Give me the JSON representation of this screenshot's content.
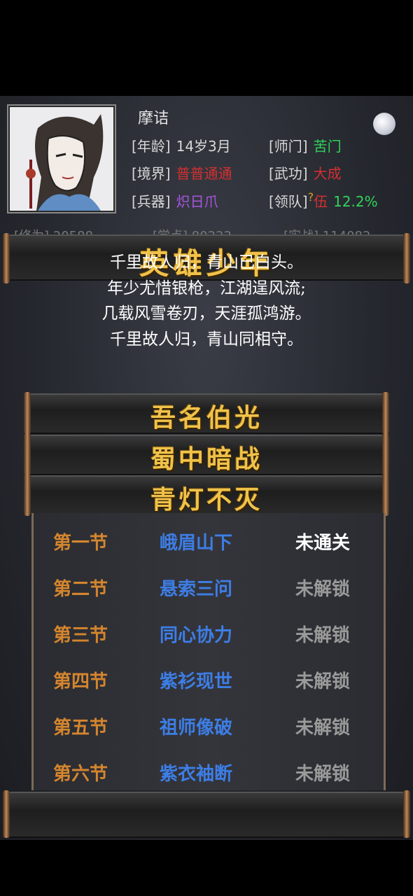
{
  "player": {
    "name": "摩诘",
    "age_label": "[年龄]",
    "age": "14岁3月",
    "sect_label": "[师门]",
    "sect": "苦门",
    "realm_label": "[境界]",
    "realm": "普普通通",
    "martial_label": "[武功]",
    "martial": "大成",
    "weapon_label": "[兵器]",
    "weapon": "炽日爪",
    "team_label": "[领队]",
    "team_icon": "?",
    "team": "伍",
    "team_pct": "12.2%"
  },
  "colors": {
    "sect": "#2fd45a",
    "realm": "#d43030",
    "martial": "#d43030",
    "weapon": "#a855e0",
    "team": "#d43030",
    "team_pct": "#2fd45a",
    "gold": "#f0c24a"
  },
  "hidden_row": [
    "[修为] 20588",
    "[学点] 80222",
    "[实战] 114082"
  ],
  "book": {
    "title": "英雄少年",
    "poem": [
      "千里故人归，青山已白头。",
      "年少尤惜银枪，江湖逞风流;",
      "几载风雪卷刃，天涯孤鸿游。",
      "千里故人归，青山同相守。"
    ],
    "chapters": [
      "吾名伯光",
      "蜀中暗战",
      "青灯不灭"
    ]
  },
  "sections": [
    {
      "section": "第一节",
      "name": "峨眉山下",
      "status": "未通关",
      "active": true
    },
    {
      "section": "第二节",
      "name": "悬索三问",
      "status": "未解锁"
    },
    {
      "section": "第三节",
      "name": "同心协力",
      "status": "未解锁"
    },
    {
      "section": "第四节",
      "name": "紫衫现世",
      "status": "未解锁"
    },
    {
      "section": "第五节",
      "name": "祖师像破",
      "status": "未解锁"
    },
    {
      "section": "第六节",
      "name": "紫衣袖断",
      "status": "未解锁"
    }
  ]
}
